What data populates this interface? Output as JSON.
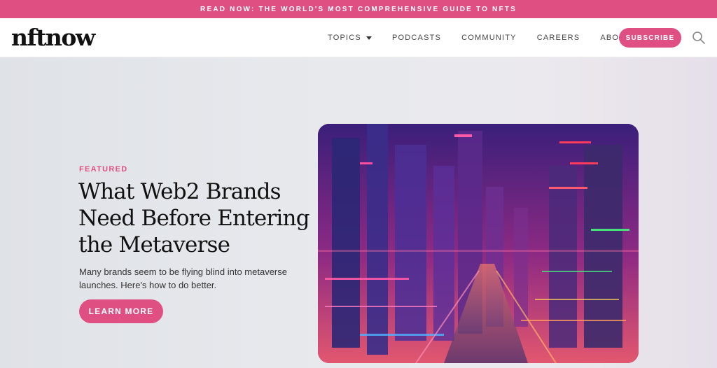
{
  "announcement": {
    "text": "READ NOW: THE WORLD'S MOST COMPREHENSIVE GUIDE TO NFTS"
  },
  "nav": {
    "logo": "nftnow",
    "items": [
      {
        "label": "TOPICS",
        "dropdown": true
      },
      {
        "label": "PODCASTS",
        "dropdown": false
      },
      {
        "label": "COMMUNITY",
        "dropdown": false
      },
      {
        "label": "CAREERS",
        "dropdown": false
      },
      {
        "label": "ABOUT",
        "dropdown": true
      }
    ],
    "subscribe_label": "SUBSCRIBE",
    "search_icon": "search-icon"
  },
  "hero": {
    "eyebrow": "FEATURED",
    "headline": "What Web2 Brands Need Before Entering the Metaverse",
    "subtitle": "Many brands seem to be flying blind into metaverse launches. Here's how to do better.",
    "cta_label": "LEARN MORE",
    "image_description": "neon-futuristic-city-illustration"
  },
  "colors": {
    "accent": "#e04f82",
    "text": "#111111",
    "hero_bg": "#e7e9ed"
  }
}
